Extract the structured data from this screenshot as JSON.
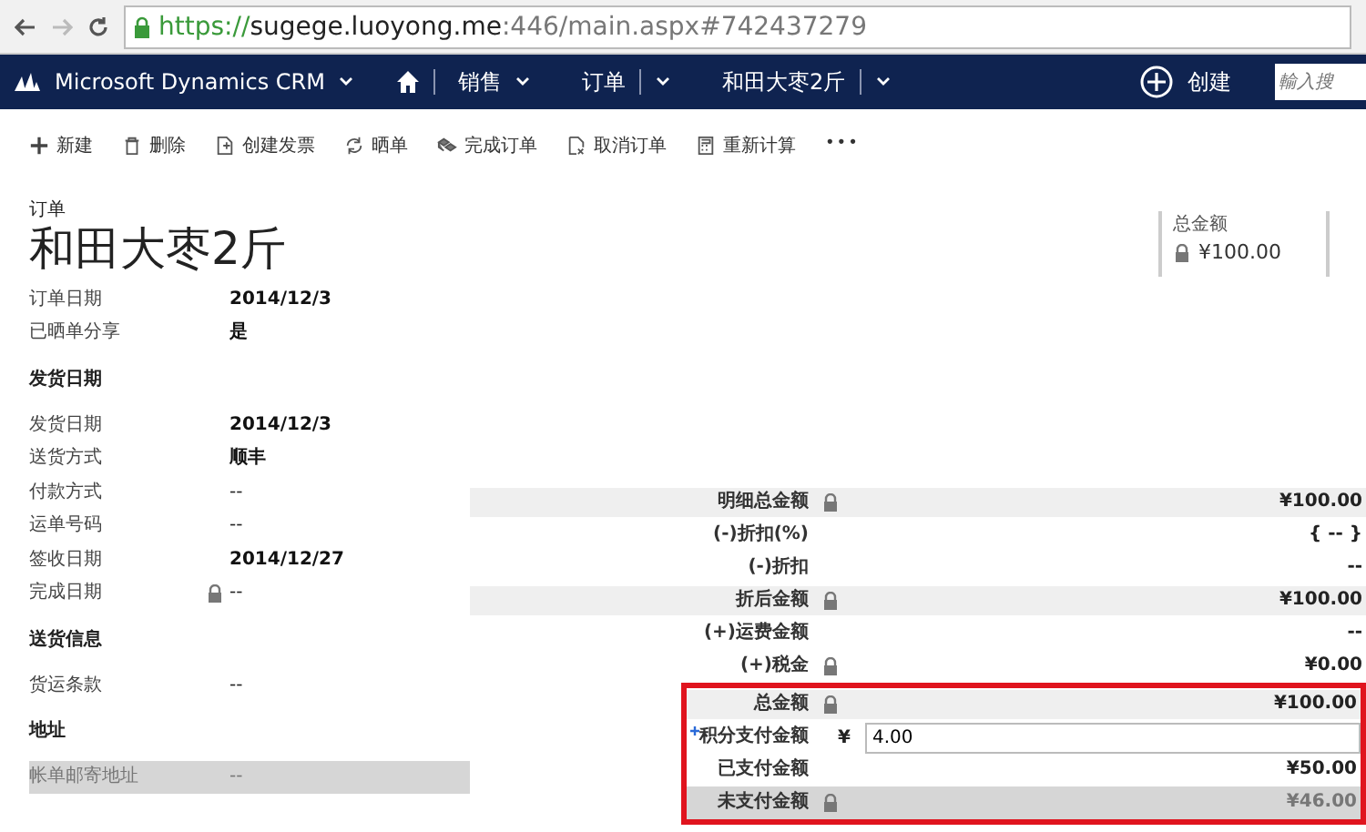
{
  "browser": {
    "url_secure": "https://",
    "url_host": "sugege.luoyong.me",
    "url_rest": ":446/main.aspx#742437279"
  },
  "navbar": {
    "app": "Microsoft Dynamics CRM",
    "crumbs": [
      {
        "label": "销售",
        "kind": "menu"
      },
      {
        "label": "订单",
        "kind": "split"
      },
      {
        "label": "和田大枣2斤",
        "kind": "split"
      }
    ],
    "create": "创建",
    "search": {
      "placeholder": "輸入搜"
    }
  },
  "commands": [
    {
      "label": "新建",
      "kind": "plus"
    },
    {
      "label": "删除",
      "kind": "trash"
    },
    {
      "label": "创建发票",
      "kind": "doc"
    },
    {
      "label": "晒单",
      "kind": "refresh"
    },
    {
      "label": "完成订单",
      "kind": "boxes"
    },
    {
      "label": "取消订单",
      "kind": "cancel"
    },
    {
      "label": "重新计算",
      "kind": "calc"
    },
    {
      "label": "•••",
      "kind": "more"
    }
  ],
  "header": {
    "entity": "订单",
    "title": "和田大枣2斤",
    "tile": {
      "label": "总金额",
      "value": "¥100.00",
      "locked": true
    }
  },
  "form": [
    {
      "kind": "field",
      "label": "订单日期",
      "value": "2014/12/3",
      "locked": false,
      "bold": true
    },
    {
      "kind": "field",
      "label": "已晒单分享",
      "value": "是",
      "locked": false,
      "bold": true
    },
    {
      "kind": "heading",
      "label": "发货日期"
    },
    {
      "kind": "field",
      "label": "发货日期",
      "value": "2014/12/3",
      "locked": false,
      "bold": true
    },
    {
      "kind": "field",
      "label": "送货方式",
      "value": "顺丰",
      "locked": false,
      "bold": true
    },
    {
      "kind": "field",
      "label": "付款方式",
      "value": "--",
      "locked": false,
      "bold": false
    },
    {
      "kind": "field",
      "label": "运单号码",
      "value": "--",
      "locked": false,
      "bold": false
    },
    {
      "kind": "field",
      "label": "签收日期",
      "value": "2014/12/27",
      "locked": false,
      "bold": true
    },
    {
      "kind": "field",
      "label": "完成日期",
      "value": "--",
      "locked": true,
      "bold": false
    },
    {
      "kind": "heading",
      "label": "送货信息"
    },
    {
      "kind": "field",
      "label": "货运条款",
      "value": "--",
      "locked": false,
      "bold": false
    },
    {
      "kind": "heading",
      "label": "地址"
    },
    {
      "kind": "field",
      "label": "帐单邮寄地址",
      "value": "--",
      "locked": false,
      "bold": false,
      "dimmed": true
    }
  ],
  "summary": {
    "rows": [
      {
        "label": "明细总金额",
        "value": "¥100.00",
        "locked": true,
        "shaded": true
      },
      {
        "label": "(-)折扣(%)",
        "value": "{ -- }",
        "locked": false,
        "shaded": false
      },
      {
        "label": "(-)折扣",
        "value": "--",
        "locked": false,
        "shaded": false
      },
      {
        "label": "折后金额",
        "value": "¥100.00",
        "locked": true,
        "shaded": true
      },
      {
        "label": "(+)运费金额",
        "value": "--",
        "locked": false,
        "shaded": false
      },
      {
        "label": "(+)税金",
        "value": "¥0.00",
        "locked": true,
        "shaded": false
      }
    ],
    "highlighted_rows": [
      {
        "label": "总金额",
        "value": "¥100.00",
        "locked": true,
        "shaded": true,
        "kind": "value"
      },
      {
        "label": "积分支付金额",
        "required": true,
        "currency": "¥",
        "value": "4.00",
        "kind": "input"
      },
      {
        "label": "已支付金额",
        "value": "¥50.00",
        "locked": false,
        "shaded": false,
        "kind": "value"
      },
      {
        "label": "未支付金额",
        "value": "¥46.00",
        "locked": true,
        "shaded": false,
        "kind": "value",
        "dimmed": true
      }
    ]
  }
}
